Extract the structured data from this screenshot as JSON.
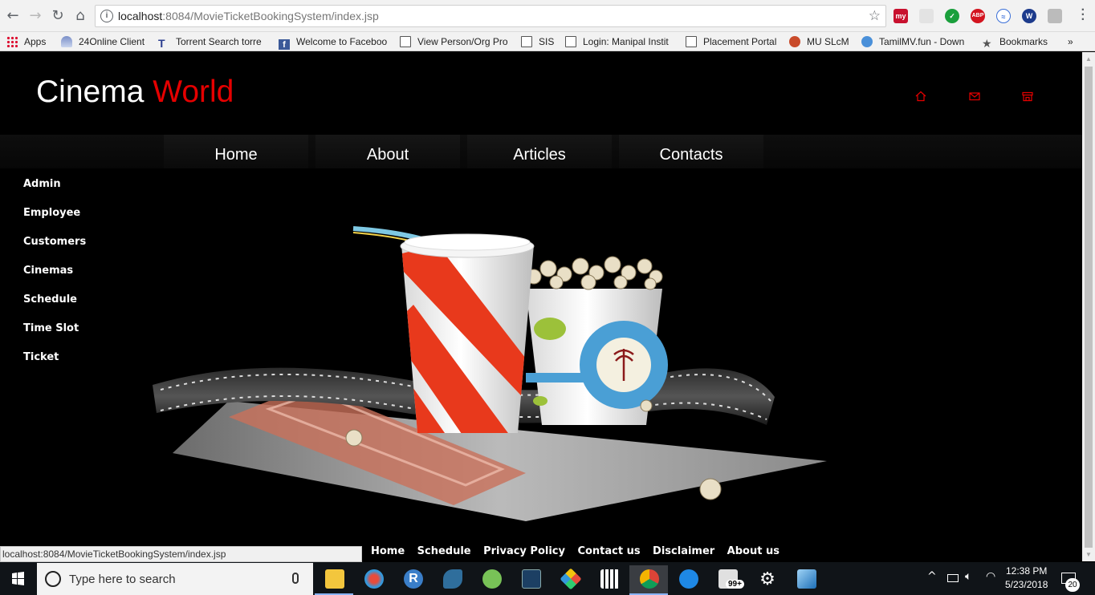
{
  "browser": {
    "url_host": "localhost",
    "url_path": ":8084/MovieTicketBookingSystem/index.jsp",
    "bookmarks": [
      {
        "label": "Apps",
        "icon": "apps-grid-icon"
      },
      {
        "label": "24Online Client",
        "icon": "online-client-icon"
      },
      {
        "label": "Torrent Search torre",
        "icon": "torrent-icon"
      },
      {
        "label": "Welcome to Faceboo",
        "icon": "facebook-icon"
      },
      {
        "label": "View Person/Org Pro",
        "icon": "page-icon"
      },
      {
        "label": "SIS",
        "icon": "page-icon"
      },
      {
        "label": "Login: Manipal Instit",
        "icon": "page-icon"
      },
      {
        "label": "Placement Portal",
        "icon": "page-icon"
      },
      {
        "label": "MU SLcM",
        "icon": "manipal-logo-icon"
      },
      {
        "label": "TamilMV.fun - Down",
        "icon": "play-icon"
      },
      {
        "label": "Bookmarks",
        "icon": "star-icon"
      }
    ],
    "overflow": "»",
    "extensions": [
      "my",
      "ABP",
      "W"
    ]
  },
  "site": {
    "logo_primary": "Cinema",
    "logo_accent": "World",
    "accent_color": "#e50000",
    "header_icons": [
      "home-icon",
      "mail-icon",
      "store-icon"
    ],
    "nav": [
      "Home",
      "About",
      "Articles",
      "Contacts"
    ],
    "side_menu": [
      "Admin",
      "Employee",
      "Customers",
      "Cinemas",
      "Schedule",
      "Time Slot",
      "Ticket"
    ],
    "footer_links": [
      "Home",
      "Schedule",
      "Privacy Policy",
      "Contact us",
      "Disclaimer",
      "About us"
    ]
  },
  "status_url": "localhost:8084/MovieTicketBookingSystem/index.jsp",
  "taskbar": {
    "search_placeholder": "Type here to search",
    "mail_badge": "99+",
    "time": "12:38 PM",
    "date": "5/23/2018",
    "notifications": "20"
  }
}
